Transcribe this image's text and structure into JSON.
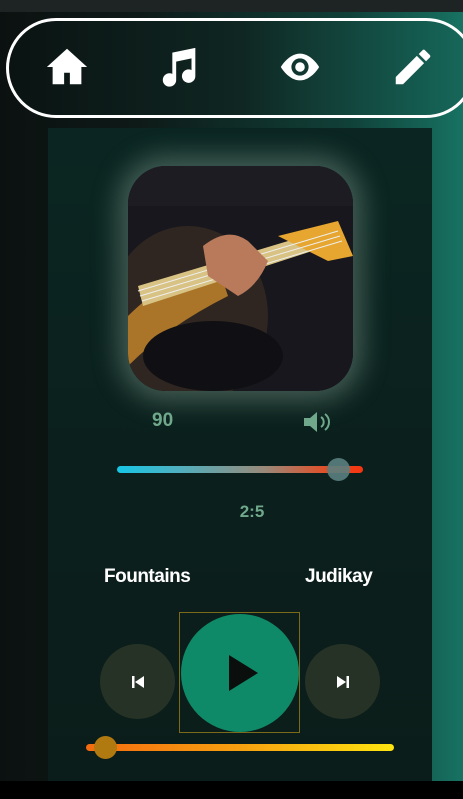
{
  "nav": {
    "items": [
      {
        "icon": "home-icon"
      },
      {
        "icon": "music-note-icon"
      },
      {
        "icon": "eye-icon"
      },
      {
        "icon": "pencil-icon"
      }
    ]
  },
  "player": {
    "cover_icon": "album-cover-bass-guitar-image",
    "volume": {
      "value": "90",
      "level": 0.9,
      "icon": "volume-icon"
    },
    "time": "2:5",
    "track": {
      "title": "Fountains",
      "artist": "Judikay"
    },
    "controls": {
      "prev_icon": "skip-previous-icon",
      "play_icon": "play-icon",
      "next_icon": "skip-next-icon"
    },
    "progress": {
      "level": 0.03
    }
  },
  "colors": {
    "accent": "#0f8a68",
    "text_muted": "#6fa88a",
    "volume_start": "#17c6e6",
    "volume_end": "#f6350f",
    "progress_start": "#f46b10",
    "progress_end": "#fee510"
  }
}
